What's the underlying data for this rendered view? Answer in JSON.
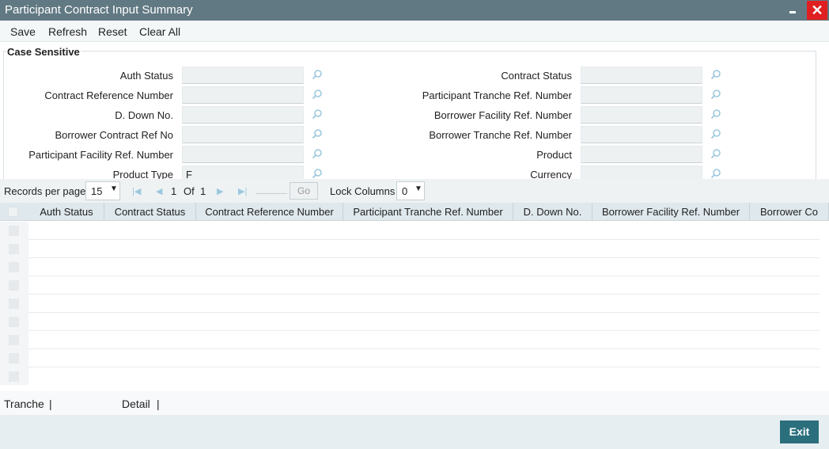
{
  "window": {
    "title": "Participant Contract Input Summary",
    "close_symbol": "✕"
  },
  "toolbar": {
    "save": "Save",
    "refresh": "Refresh",
    "reset": "Reset",
    "clear_all": "Clear All"
  },
  "search": {
    "legend": "Case Sensitive",
    "left_fields": [
      {
        "label": "Auth Status",
        "value": ""
      },
      {
        "label": "Contract Reference Number",
        "value": ""
      },
      {
        "label": "D. Down No.",
        "value": ""
      },
      {
        "label": "Borrower Contract Ref No",
        "value": ""
      },
      {
        "label": "Participant Facility Ref. Number",
        "value": ""
      },
      {
        "label": "Product Type",
        "value": "F"
      }
    ],
    "right_fields": [
      {
        "label": "Contract Status",
        "value": ""
      },
      {
        "label": "Participant Tranche Ref. Number",
        "value": ""
      },
      {
        "label": "Borrower Facility Ref. Number",
        "value": ""
      },
      {
        "label": "Borrower Tranche Ref. Number",
        "value": ""
      },
      {
        "label": "Product",
        "value": ""
      },
      {
        "label": "Currency",
        "value": ""
      }
    ]
  },
  "pager": {
    "records_label": "Records per page",
    "records_value": "15",
    "page_current": "1",
    "of_label": "Of",
    "page_total": "1",
    "go_label": "Go",
    "lock_label": "Lock Columns",
    "lock_value": "0"
  },
  "grid": {
    "columns": [
      "Auth Status",
      "Contract Status",
      "Contract Reference Number",
      "Participant Tranche Ref. Number",
      "D. Down No.",
      "Borrower Facility Ref. Number",
      "Borrower Co"
    ],
    "row_count": 9
  },
  "links": {
    "tranche": "Tranche",
    "detail": "Detail",
    "separator": "|"
  },
  "footer": {
    "exit": "Exit"
  },
  "colors": {
    "titlebar": "#617983",
    "close": "#e02020",
    "exit_button": "#2b6f7d",
    "lookup_icon": "#9cc8dd"
  }
}
